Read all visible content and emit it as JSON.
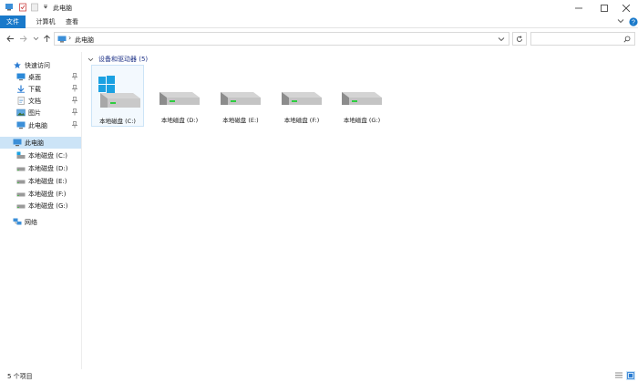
{
  "window": {
    "title": "此电脑",
    "minimize_icon": "minimize-icon",
    "maximize_icon": "maximize-icon",
    "close_icon": "close-icon"
  },
  "ribbon": {
    "tabs": [
      {
        "label": "文件",
        "active": true
      },
      {
        "label": "计算机"
      },
      {
        "label": "查看"
      }
    ],
    "accent_color": "#1979ca"
  },
  "address_bar": {
    "path": "此电脑",
    "search_placeholder": ""
  },
  "sidebar": {
    "quick_access": {
      "label": "快速访问",
      "items": [
        {
          "label": "桌面",
          "pinned": true,
          "icon": "desktop-icon"
        },
        {
          "label": "下载",
          "pinned": true,
          "icon": "download-icon"
        },
        {
          "label": "文档",
          "pinned": true,
          "icon": "documents-icon"
        },
        {
          "label": "图片",
          "pinned": true,
          "icon": "pictures-icon"
        },
        {
          "label": "此电脑",
          "pinned": true,
          "icon": "this-pc-icon"
        }
      ]
    },
    "this_pc": {
      "label": "此电脑",
      "selected": true,
      "drives": [
        {
          "label": "本地磁盘 (C:)"
        },
        {
          "label": "本地磁盘 (D:)"
        },
        {
          "label": "本地磁盘 (E:)"
        },
        {
          "label": "本地磁盘 (F:)"
        },
        {
          "label": "本地磁盘 (G:)"
        }
      ]
    },
    "network": {
      "label": "网络"
    }
  },
  "main": {
    "group_header": "设备和驱动器 (5)",
    "drives": [
      {
        "label": "本地磁盘 (C:)",
        "system": true
      },
      {
        "label": "本地磁盘 (D:)"
      },
      {
        "label": "本地磁盘 (E:)"
      },
      {
        "label": "本地磁盘 (F:)"
      },
      {
        "label": "本地磁盘 (G:)"
      }
    ]
  },
  "status_bar": {
    "item_count": "5 个项目"
  }
}
